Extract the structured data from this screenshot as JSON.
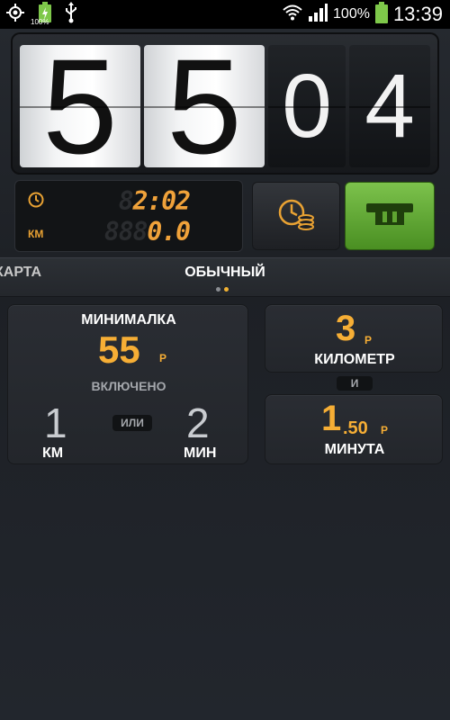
{
  "status_bar": {
    "left_icons": [
      "gps-icon",
      "battery-charging-icon",
      "usb-icon"
    ],
    "small_battery_label": "100%",
    "right_icons": [
      "wifi-icon",
      "signal-icon",
      "battery-icon"
    ],
    "battery_percent": "100%",
    "time": "13:39"
  },
  "counter": {
    "digits": [
      "5",
      "5",
      "0",
      "4"
    ]
  },
  "lcd": {
    "clock_icon": "clock-icon",
    "km_label": "КМ",
    "time_ghost": "8",
    "time_value": "2:02",
    "distance_ghost": "888",
    "distance_value": "0.0"
  },
  "buttons": {
    "tariff_icon": "clock-coins-icon",
    "pause_icon": "pause-ticket-icon"
  },
  "tabs": {
    "left": "КАРТА",
    "center": "ОБЫЧНЫЙ",
    "page_count": 2,
    "active_index": 1
  },
  "tariff": {
    "minimal": {
      "title": "МИНИМАЛКА",
      "value": "55",
      "currency": "Р",
      "included": "ВКЛЮЧЕНО",
      "km_value": "1",
      "or": "ИЛИ",
      "min_value": "2",
      "km_unit": "КМ",
      "min_unit": "МИН"
    },
    "per_km": {
      "value": "3",
      "currency": "Р",
      "label": "КИЛОМЕТР"
    },
    "and": "И",
    "per_min": {
      "value": "1",
      "decimal": ".50",
      "currency": "Р",
      "label": "МИНУТА"
    }
  },
  "colors": {
    "accent": "#f6ae35",
    "active_button": "#5fa531",
    "background": "#1f2227"
  }
}
